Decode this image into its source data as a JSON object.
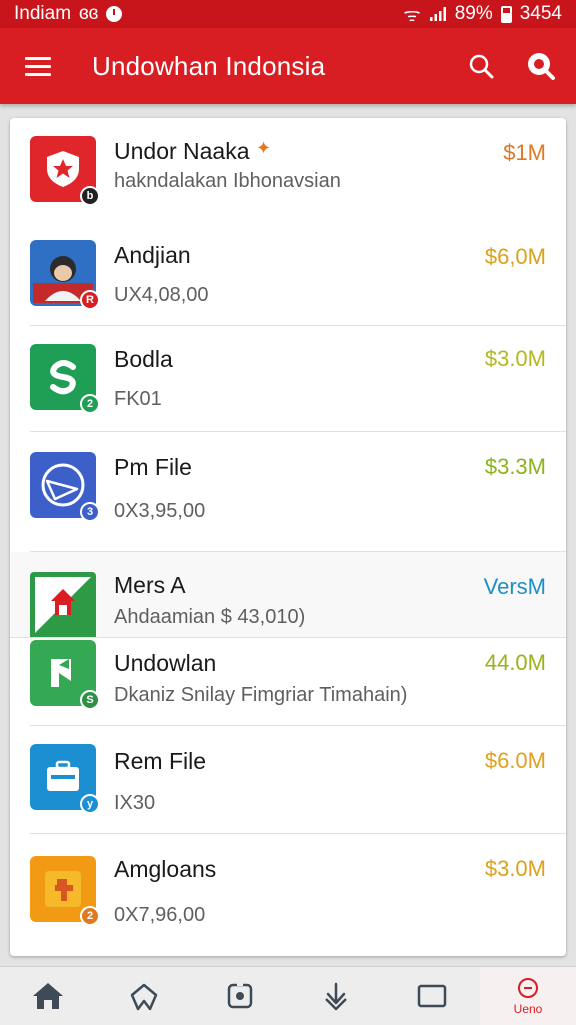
{
  "status_bar": {
    "left_text": "Indiam",
    "left_extra": "ɞɞ",
    "battery_percent": "89%",
    "time": "3454",
    "signal_glyph": "ᯤ"
  },
  "app_bar": {
    "title": "Undowhan Indonsia",
    "menu_icon": "hamburger-icon",
    "search_icon": "search-icon",
    "second_icon": "search-filled-icon"
  },
  "colors": {
    "primary": "#d81e23",
    "status_bar": "#c8151c",
    "price_orange": "#e07a22",
    "price_yellow": "#d8a21c",
    "price_olive": "#9bb21e",
    "price_green": "#6aa525",
    "price_blue": "#1e8fc4"
  },
  "apps": [
    {
      "name": "Undor Naaka",
      "subtitle": "hakndalakan Ibhonavsian",
      "price": "$1M",
      "icon": "shield-star-icon",
      "badge": "b",
      "price_color": "#e07a22"
    },
    {
      "name": "Andjian",
      "subtitle": "UX4,08,00",
      "price": "$6,0M",
      "icon": "avatar-photo-icon",
      "badge": "R",
      "price_color": "#d8a21c"
    },
    {
      "name": "Bodla",
      "subtitle": "FK01",
      "price": "$3.0M",
      "icon": "green-s-icon",
      "badge": "2",
      "price_color": "#b4b81e"
    },
    {
      "name": "Pm File",
      "subtitle": "0X3,95,00",
      "price": "$3.3M",
      "icon": "compass-icon",
      "badge": "3",
      "price_color": "#8cb21e"
    },
    {
      "name": "Mers A",
      "subtitle": "Ahdaamian $ 43,010)",
      "price": "VersM",
      "icon": "home-map-icon",
      "badge": "",
      "price_color": "#1e8fc4"
    },
    {
      "name": "Undowlan",
      "subtitle": "Dkaniz Snilay Fimgriar Timahain)",
      "price": "44.0M",
      "icon": "green-flag-icon",
      "badge": "S",
      "price_color": "#9bb21e"
    },
    {
      "name": "Rem File",
      "subtitle": "IX30",
      "price": "$6.0M",
      "icon": "briefcase-icon",
      "badge": "y",
      "price_color": "#e0a020"
    },
    {
      "name": "Amgloans",
      "subtitle": "0X7,96,00",
      "price": "$3.0M",
      "icon": "orange-t-icon",
      "badge": "2",
      "price_color": "#d8a21c"
    }
  ],
  "bottom_nav": {
    "items": [
      {
        "icon": "home-icon"
      },
      {
        "icon": "bookmark-icon"
      },
      {
        "icon": "screenshot-icon"
      },
      {
        "icon": "download-icon"
      },
      {
        "icon": "square-icon"
      },
      {
        "icon": "clock-icon",
        "label": "Ueno"
      }
    ]
  }
}
